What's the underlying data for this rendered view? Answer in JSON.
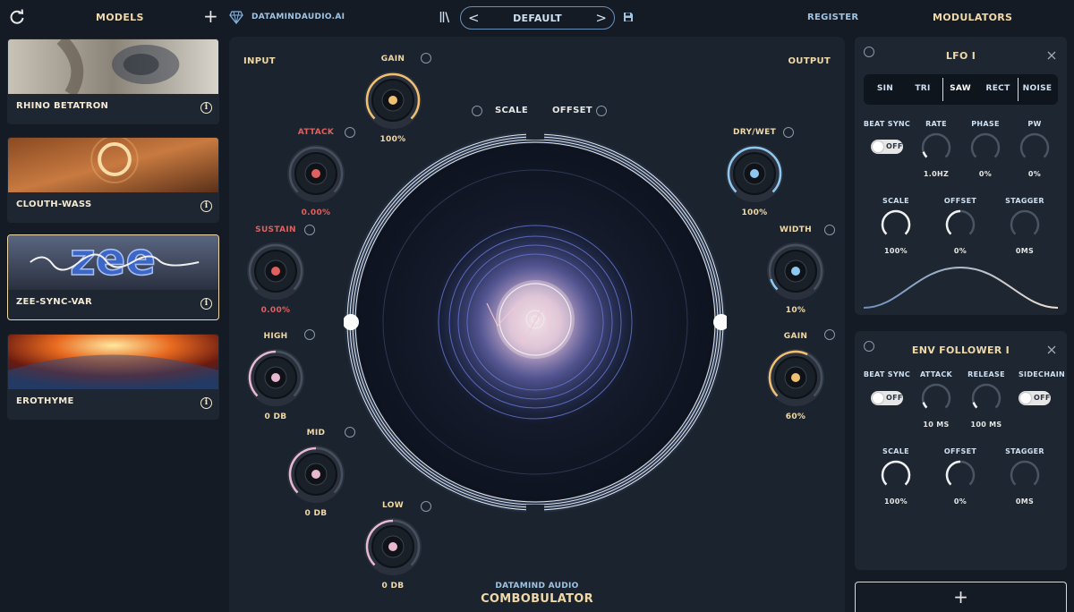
{
  "topbar": {
    "models_title": "MODELS",
    "add_symbol": "+",
    "brand": "DATAMINDAUDIO.AI",
    "preset_name": "DEFAULT",
    "prev_arrow": "<",
    "next_arrow": ">",
    "register": "REGISTER",
    "modulators_title": "MODULATORS",
    "icons": [
      "refresh-icon",
      "add-icon",
      "diamond-logo-icon",
      "library-icon",
      "chevron-left-icon",
      "chevron-right-icon",
      "save-icon"
    ]
  },
  "models": [
    {
      "name": "RHINO BETATRON",
      "info": "i",
      "selected": false
    },
    {
      "name": "CLOUTH-WASS",
      "info": "i",
      "selected": false
    },
    {
      "name": "ZEE-SYNC-VAR",
      "info": "i",
      "selected": true
    },
    {
      "name": "EROTHYME",
      "info": "i",
      "selected": false
    }
  ],
  "center": {
    "input_label": "INPUT",
    "output_label": "OUTPUT",
    "scale_label": "SCALE",
    "offset_label": "OFFSET",
    "footer_brand": "DATAMIND AUDIO",
    "footer_product": "COMBOBULATOR",
    "knobs": {
      "in_gain": {
        "label": "GAIN",
        "value": "100%",
        "level": 1.0,
        "color": "#f0c070"
      },
      "attack": {
        "label": "ATTACK",
        "value": "0.00%",
        "level": 0.0,
        "color": "#e0605f"
      },
      "sustain": {
        "label": "SUSTAIN",
        "value": "0.00%",
        "level": 0.0,
        "color": "#e0605f"
      },
      "high": {
        "label": "HIGH",
        "value": "0 DB",
        "level": 0.5,
        "color": "#e8b8d0"
      },
      "mid": {
        "label": "MID",
        "value": "0 DB",
        "level": 0.5,
        "color": "#e8b8d0"
      },
      "low": {
        "label": "LOW",
        "value": "0 DB",
        "level": 0.5,
        "color": "#e8b8d0"
      },
      "dry_wet": {
        "label": "DRY/WET",
        "value": "100%",
        "level": 1.0,
        "color": "#8ec8f0"
      },
      "width": {
        "label": "WIDTH",
        "value": "10%",
        "level": 0.1,
        "color": "#8ec8f0"
      },
      "out_gain": {
        "label": "GAIN",
        "value": "60%",
        "level": 0.6,
        "color": "#f0c070"
      }
    }
  },
  "lfo": {
    "title": "LFO I",
    "waves": [
      "SIN",
      "TRI",
      "SAW",
      "RECT",
      "NOISE"
    ],
    "selected_wave": "SAW",
    "beat_sync_label": "BEAT SYNC",
    "beat_sync_value": "OFF",
    "rate": {
      "label": "RATE",
      "value": "1.0HZ",
      "level": 0.1
    },
    "phase": {
      "label": "PHASE",
      "value": "0%",
      "level": 0.0
    },
    "pw": {
      "label": "PW",
      "value": "0%",
      "level": 0.0
    },
    "scale": {
      "label": "SCALE",
      "value": "100%",
      "level": 1.0
    },
    "offset": {
      "label": "OFFSET",
      "value": "0%",
      "level": 0.5
    },
    "stagger": {
      "label": "STAGGER",
      "value": "0MS",
      "level": 0.0
    }
  },
  "env": {
    "title": "ENV FOLLOWER I",
    "beat_sync_label": "BEAT SYNC",
    "beat_sync_value": "OFF",
    "attack": {
      "label": "ATTACK",
      "value": "10 MS",
      "level": 0.1
    },
    "release": {
      "label": "RELEASE",
      "value": "100 MS",
      "level": 0.1
    },
    "sidechain_label": "SIDECHAIN",
    "sidechain_value": "OFF",
    "scale": {
      "label": "SCALE",
      "value": "100%",
      "level": 1.0
    },
    "offset": {
      "label": "OFFSET",
      "value": "0%",
      "level": 0.5
    },
    "stagger": {
      "label": "STAGGER",
      "value": "0MS",
      "level": 0.0
    }
  },
  "add_modulator": "+",
  "colors": {
    "bg": "#141b24",
    "panel": "#1b232e",
    "cream": "#f0d9a8",
    "blue": "#9fc4e4"
  }
}
